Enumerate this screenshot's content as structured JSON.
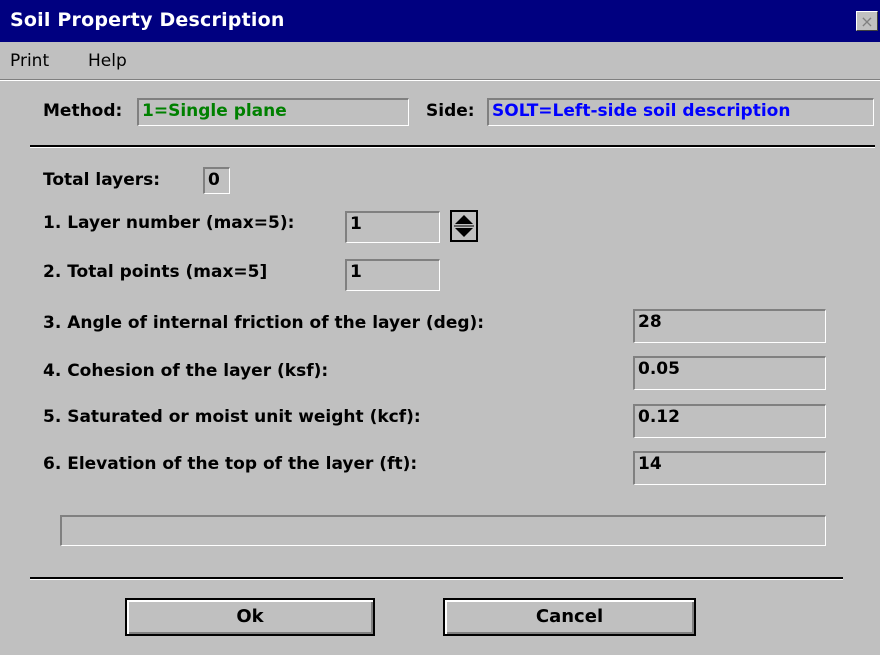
{
  "window": {
    "title": "Soil Property Description",
    "close_symbol": "×"
  },
  "menu": {
    "items": [
      "Print",
      "Help"
    ]
  },
  "header": {
    "method_label": "Method:",
    "method_value": "1=Single plane",
    "side_label": "Side:",
    "side_value": "SOLT=Left-side soil description"
  },
  "form": {
    "total_layers_label": "Total layers:",
    "total_layers_value": "0",
    "layer_number_label": "1. Layer number (max=5):",
    "layer_number_value": "1",
    "total_points_label": "2. Total points (max=5]",
    "total_points_value": "1",
    "friction_label": "3. Angle of internal friction of the layer (deg):",
    "friction_value": "28",
    "cohesion_label": "4. Cohesion of the layer (ksf):",
    "cohesion_value": "0.05",
    "unit_weight_label": "5. Saturated or moist unit weight (kcf):",
    "unit_weight_value": "0.12",
    "elevation_label": "6. Elevation of the top of the layer (ft):",
    "elevation_value": "14",
    "message_value": ""
  },
  "buttons": {
    "ok": "Ok",
    "cancel": "Cancel"
  },
  "colors": {
    "title_bar": "#000080",
    "method_text": "#008000",
    "side_text": "#0000ff",
    "face": "#c0c0c0"
  }
}
